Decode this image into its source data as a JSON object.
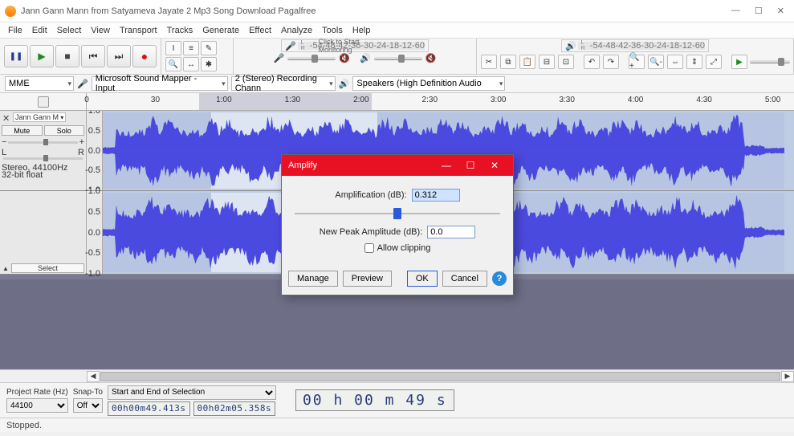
{
  "window": {
    "title": "Jann Gann Mann from Satyameva Jayate 2 Mp3 Song Download Pagalfree",
    "minimize": "—",
    "maximize": "☐",
    "close": "✕"
  },
  "menu": [
    "File",
    "Edit",
    "Select",
    "View",
    "Transport",
    "Tracks",
    "Generate",
    "Effect",
    "Analyze",
    "Tools",
    "Help"
  ],
  "rec_meter": {
    "click_label": "Click to Start Monitoring",
    "ticks": [
      "-54",
      "-48",
      "-42",
      "-36",
      "-30",
      "-24",
      "-18",
      "-12",
      "-6",
      "0"
    ]
  },
  "play_meter": {
    "ticks": [
      "-54",
      "-48",
      "-42",
      "-36",
      "-30",
      "-24",
      "-18",
      "-12",
      "-6",
      "0"
    ]
  },
  "devices": {
    "host": "MME",
    "input": "Microsoft Sound Mapper - Input",
    "channels": "2 (Stereo) Recording Chann",
    "output": "Speakers (High Definition Audio"
  },
  "timeline": {
    "marks": [
      {
        "t": "0",
        "pct": 0
      },
      {
        "t": "30",
        "pct": 9.7
      },
      {
        "t": "1:00",
        "pct": 19.4
      },
      {
        "t": "1:30",
        "pct": 29.1
      },
      {
        "t": "2:00",
        "pct": 38.8
      },
      {
        "t": "2:30",
        "pct": 48.5
      },
      {
        "t": "3:00",
        "pct": 58.2
      },
      {
        "t": "3:30",
        "pct": 67.9
      },
      {
        "t": "4:00",
        "pct": 77.6
      },
      {
        "t": "4:30",
        "pct": 87.3
      },
      {
        "t": "5:00",
        "pct": 97.0
      }
    ],
    "sel_start_pct": 15.9,
    "sel_end_pct": 40.3
  },
  "track": {
    "name": "Jann Gann M",
    "mute": "Mute",
    "solo": "Solo",
    "left": "L",
    "right": "R",
    "info1": "Stereo, 44100Hz",
    "info2": "32-bit float",
    "select": "Select",
    "yticks": [
      "1.0",
      "0.5",
      "0.0",
      "-0.5",
      "-1.0"
    ]
  },
  "dialog": {
    "title": "Amplify",
    "amp_label": "Amplification (dB):",
    "amp_value": "0.312",
    "peak_label": "New Peak Amplitude (dB):",
    "peak_value": "0.0",
    "clip_label": "Allow clipping",
    "manage": "Manage",
    "preview": "Preview",
    "ok": "OK",
    "cancel": "Cancel"
  },
  "bottom": {
    "project_rate_label": "Project Rate (Hz)",
    "project_rate": "44100",
    "snap_label": "Snap-To",
    "snap": "Off",
    "selection_label": "Start and End of Selection",
    "sel_start": "00h00m49.413s",
    "sel_end": "00h02m05.358s",
    "bigtime": "00 h 00 m 49 s"
  },
  "status": "Stopped."
}
